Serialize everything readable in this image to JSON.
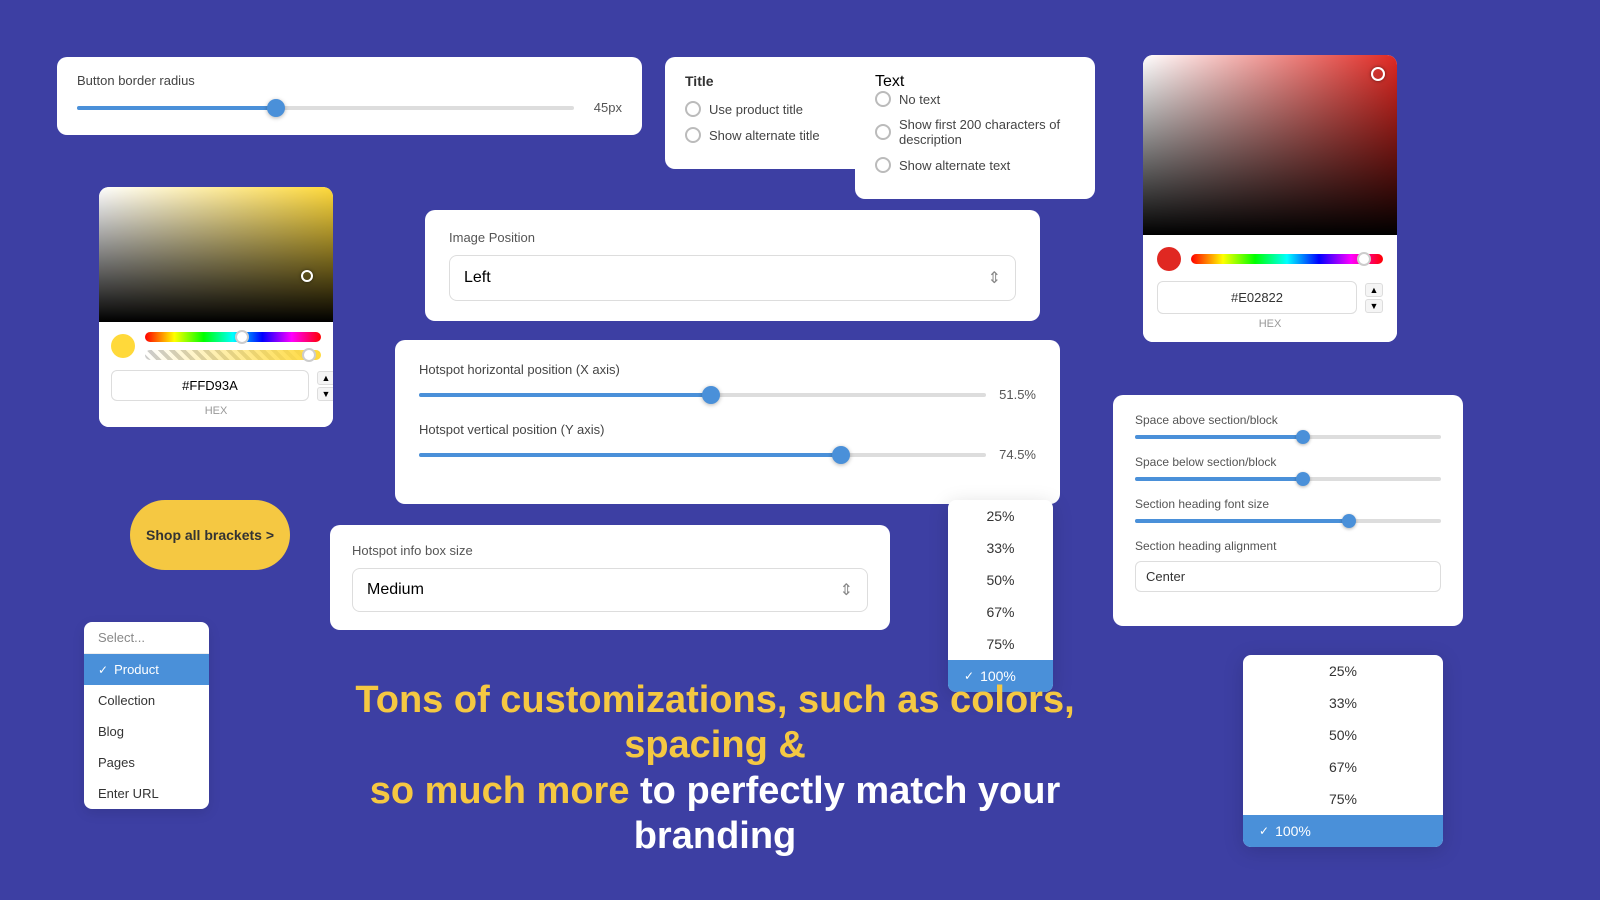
{
  "background_color": "#3d3fa3",
  "border_radius_card": {
    "label": "Button border radius",
    "value": "45px",
    "fill_percent": 40
  },
  "title_card": {
    "heading": "Title",
    "options": [
      "Use product title",
      "Show alternate title"
    ]
  },
  "text_card": {
    "heading": "Text",
    "options": [
      "No text",
      "Show first 200 characters of description",
      "Show alternate text"
    ]
  },
  "color_picker_red": {
    "hex_value": "#E02822",
    "hex_label": "HEX"
  },
  "color_picker_yellow": {
    "hex_value": "#FFD93A",
    "hex_label": "HEX"
  },
  "image_position": {
    "label": "Image Position",
    "value": "Left"
  },
  "hotspot_x": {
    "label": "Hotspot horizontal position (X axis)",
    "value": "51.5%",
    "fill_percent": 51.5
  },
  "hotspot_y": {
    "label": "Hotspot vertical position (Y axis)",
    "value": "74.5%",
    "fill_percent": 74.5
  },
  "shop_button": {
    "label": "Shop all brackets >"
  },
  "hotspot_size": {
    "label": "Hotspot info box size",
    "value": "Medium"
  },
  "dropdown_pct": {
    "items": [
      "25%",
      "33%",
      "50%",
      "67%",
      "75%",
      "100%"
    ],
    "selected": "100%",
    "check": "✓"
  },
  "dropdown_pct_right": {
    "items": [
      "25%",
      "33%",
      "50%",
      "67%",
      "75%",
      "100%"
    ],
    "selected": "100%",
    "check": "✓"
  },
  "select_dropdown": {
    "placeholder": "Select...",
    "items": [
      "Product",
      "Collection",
      "Blog",
      "Pages",
      "Enter URL"
    ],
    "selected": "Product",
    "check": "✓"
  },
  "space_card": {
    "above_label": "Space above section/block",
    "below_label": "Space below section/block",
    "font_size_label": "Section heading font size",
    "alignment_label": "Section heading alignment",
    "alignment_value": "Center",
    "above_fill": 55,
    "below_fill": 55,
    "font_fill": 70
  },
  "bottom_text": {
    "line1_yellow": "Tons of customizations, such as colors, spacing &",
    "line2_yellow": "so much more",
    "line2_white": " to perfectly match your branding"
  }
}
